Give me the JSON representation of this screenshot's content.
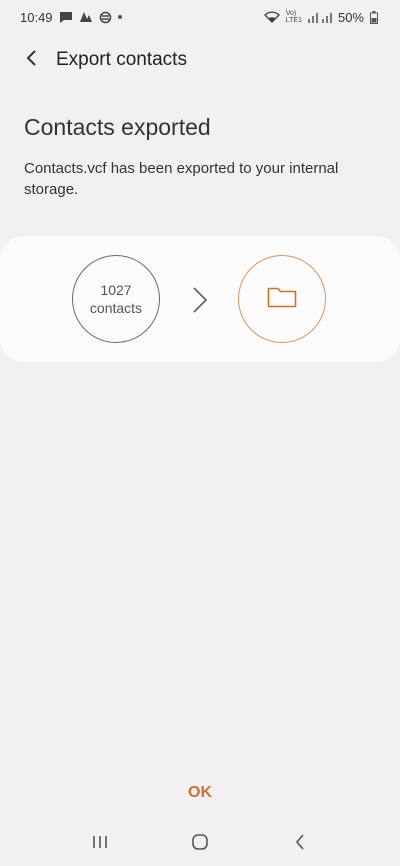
{
  "status_bar": {
    "time": "10:49",
    "network_top": "Vo)",
    "network_bottom": "LTE1",
    "battery": "50%"
  },
  "app_bar": {
    "title": "Export contacts"
  },
  "content": {
    "heading": "Contacts exported",
    "description": "Contacts.vcf has been exported to your internal storage."
  },
  "transfer": {
    "count": "1027",
    "count_label": "contacts"
  },
  "actions": {
    "ok_label": "OK"
  },
  "colors": {
    "accent": "#c2752f",
    "background": "#f3f0f4",
    "card": "#fcfbfc"
  },
  "icons": [
    "message-icon",
    "assistant-icon",
    "sync-icon",
    "wifi-icon",
    "signal-icon",
    "battery-icon",
    "back-arrow-icon",
    "chevron-right-icon",
    "folder-icon",
    "recents-icon",
    "home-icon",
    "back-icon"
  ]
}
